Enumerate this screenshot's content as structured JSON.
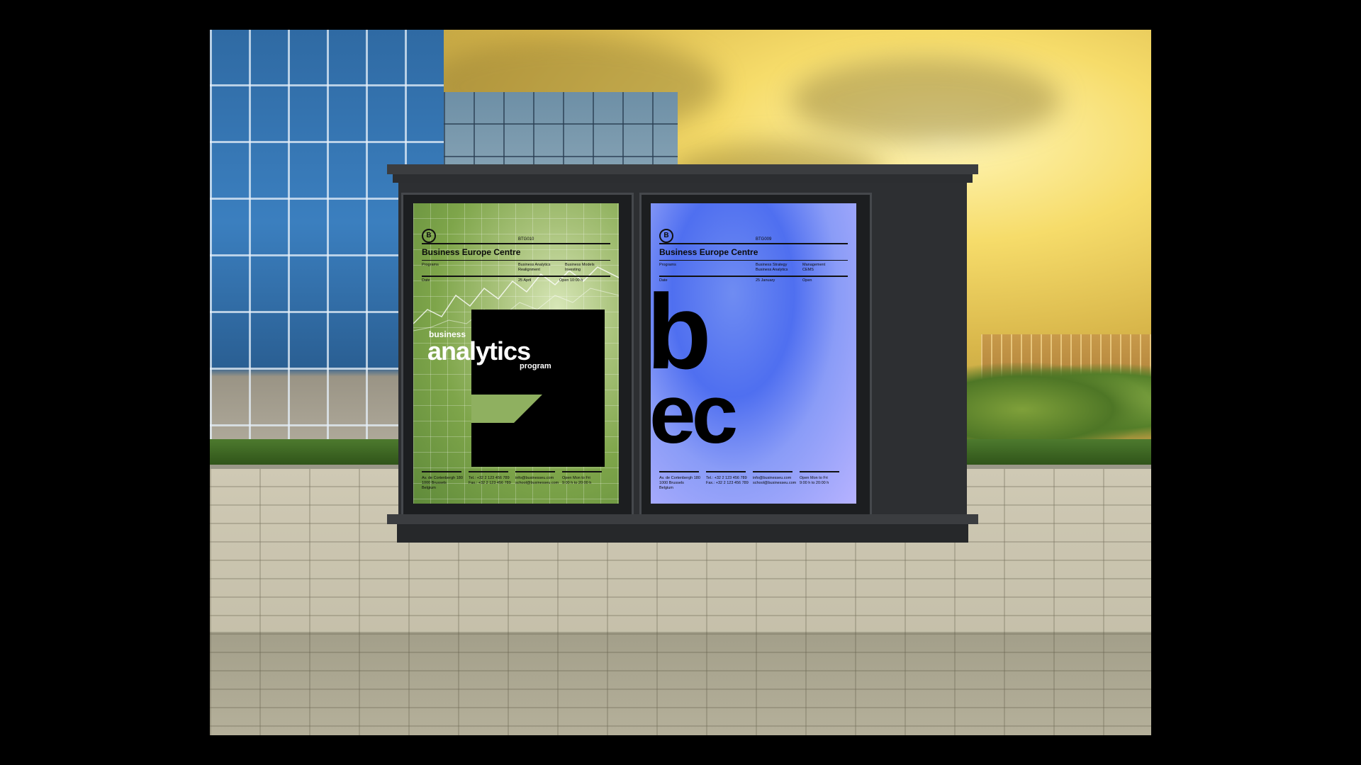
{
  "scene": {
    "description_colors": {
      "sky": "#f6dc6a",
      "glass": "#3b7fbf",
      "kiosk": "#2d2f32"
    }
  },
  "poster_left": {
    "logo": "B",
    "code": "BTG010",
    "title": "Business Europe Centre",
    "programs_label": "Programs",
    "programs_1": "Business Analytics",
    "programs_1b": "Realignment",
    "programs_2": "Business Models",
    "programs_2b": "Investing",
    "date_label": "Date",
    "date_value": "25 April",
    "open_value": "Open 10:00 h",
    "headline_small": "business",
    "headline_big": "analytics",
    "headline_sub": "program",
    "footer": [
      {
        "l1": "Av. de Cortenbergh 180",
        "l2": "1000 Brussels",
        "l3": "Belgium"
      },
      {
        "l1": "Tel.: +32 2 123 456 789",
        "l2": "Fax.: +32 2 123 456 789",
        "l3": ""
      },
      {
        "l1": "info@businesseu.com",
        "l2": "school@businesseu.com",
        "l3": ""
      },
      {
        "l1": "Open Mon to Fri",
        "l2": "9:00 h to 20:00 h",
        "l3": ""
      }
    ]
  },
  "poster_right": {
    "logo": "B",
    "code": "BTG009",
    "title": "Business Europe Centre",
    "programs_label": "Programs",
    "programs_1": "Business Strategy",
    "programs_1b": "Business Analytics",
    "programs_2": "Management",
    "programs_2b": "CEMS",
    "date_label": "Date",
    "date_value": "25 January",
    "open_value": "Open",
    "big_line1": "b",
    "big_line2": "ec",
    "footer": [
      {
        "l1": "Av. de Cortenbergh 180",
        "l2": "1000 Brussels",
        "l3": "Belgium"
      },
      {
        "l1": "Tel.: +32 2 123 456 789",
        "l2": "Fax.: +32 2 123 456 789",
        "l3": ""
      },
      {
        "l1": "info@businesseu.com",
        "l2": "school@businesseu.com",
        "l3": ""
      },
      {
        "l1": "Open Mon to Fri",
        "l2": "9:00 h to 20:00 h",
        "l3": ""
      }
    ]
  }
}
